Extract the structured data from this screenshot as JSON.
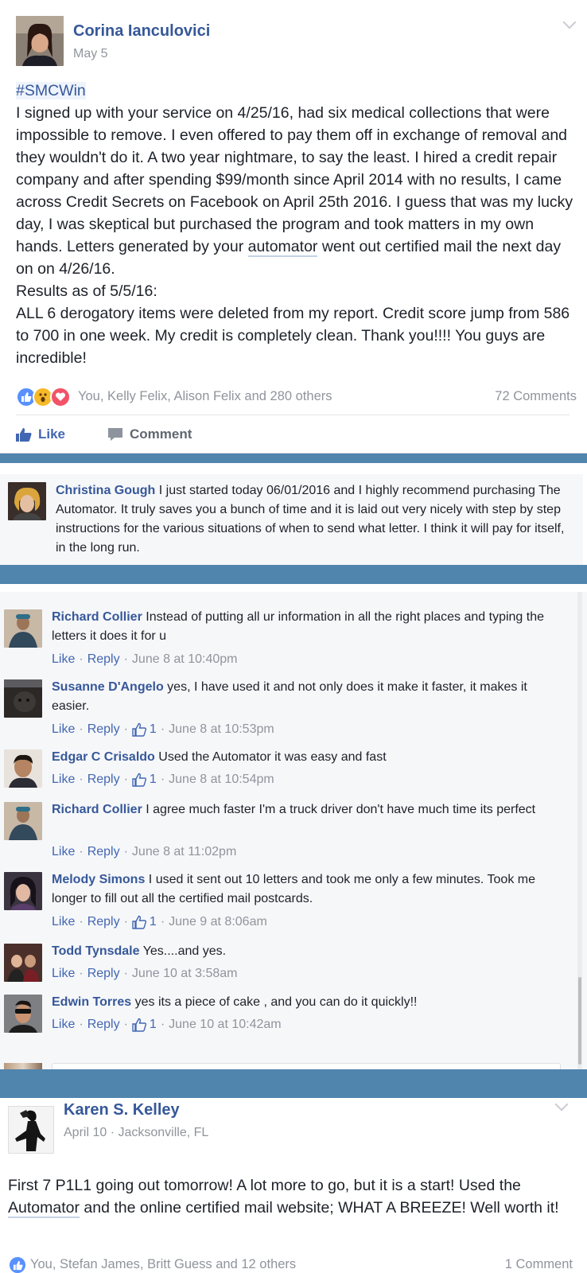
{
  "post1": {
    "author": "Corina Ianculovici",
    "date": "May 5",
    "hashtag": "#SMCWin",
    "body_part1": "I signed up with your service on 4/25/16, had six medical collections that were impossible to remove. I even offered to pay them off in exchange of removal and they wouldn't do it. A two year nightmare, to say the least. I hired a credit repair company and after spending $99/month since April 2014 with no results, I came across Credit Secrets on Facebook on April 25th 2016. I guess that was my lucky day, I was skeptical but purchased the program and took matters in my own hands. Letters generated by your ",
    "body_link": "automator",
    "body_part2": " went out certified mail the next day on on 4/26/16.",
    "results_line": "Results as of 5/5/16:",
    "results_body": "ALL 6 derogatory items were deleted from my report. Credit score jump from 586 to 700 in one week. My credit is completely clean. Thank you!!!! You guys are incredible!",
    "reactions_text": "You, Kelly Felix, Alison Felix and 280 others",
    "comments_count": "72 Comments",
    "like_label": "Like",
    "comment_label": "Comment"
  },
  "christina": {
    "name": "Christina Gough",
    "text": " I just started today 06/01/2016 and I highly recommend purchasing The Automator. It truly saves you a bunch of time and it is laid out very nicely with step by step instructions for the various situations of when to send what letter. I think it will pay for itself, in the long run."
  },
  "comment_labels": {
    "like": "Like",
    "reply": "Reply",
    "dot": "·"
  },
  "comments": [
    {
      "name": "Richard Collier",
      "text": " Instead of putting all ur information in all the right places and typing the letters it does it for u",
      "likes": "",
      "time": "June 8 at 10:40pm"
    },
    {
      "name": "Susanne D'Angelo",
      "text": " yes, I have used it and not only does it make it faster, it makes it easier.",
      "likes": "1",
      "time": "June 8 at 10:53pm"
    },
    {
      "name": "Edgar C Crisaldo",
      "text": " Used the Automator it was easy and fast",
      "likes": "1",
      "time": "June 8 at 10:54pm"
    },
    {
      "name": "Richard Collier",
      "text": " I agree much faster I'm a truck driver don't have much time its perfect",
      "likes": "",
      "time": "June 8 at 11:02pm"
    },
    {
      "name": "Melody Simons",
      "text": " I used it sent out 10 letters and took me only a few minutes. Took me longer to fill out all the certified mail postcards.",
      "likes": "1",
      "time": "June 9 at 8:06am"
    },
    {
      "name": "Todd Tynsdale",
      "text": " Yes....and yes.",
      "likes": "",
      "time": "June 10 at 3:58am"
    },
    {
      "name": "Edwin Torres",
      "text": " yes its a piece of cake , and you can do it quickly!!",
      "likes": "1",
      "time": "June 10 at 10:42am"
    }
  ],
  "post2": {
    "author": "Karen S. Kelley",
    "date_location": "April 10 · Jacksonville, FL",
    "body_part1": "First 7 P1L1 going out tomorrow! A lot more to go, but it is a start! Used the ",
    "body_link": "Automator",
    "body_part2": " and the online certified mail website; WHAT A BREEZE! Well worth it!",
    "reactions_text": "You, Stefan James, Britt Guess and 12 others",
    "comments_count": "1 Comment"
  },
  "colors": {
    "accent": "#365899",
    "link_blue": "#4267b2",
    "divider": "#5085ae",
    "meta": "#90949c"
  }
}
